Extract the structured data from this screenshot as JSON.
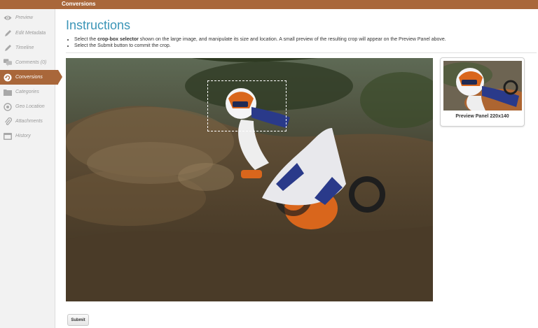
{
  "topbar": {
    "title": "Conversions"
  },
  "sidebar": {
    "items": [
      {
        "label": "Preview",
        "icon": "eye-icon",
        "active": false
      },
      {
        "label": "Edit Metadata",
        "icon": "pencil-icon",
        "active": false
      },
      {
        "label": "Timeline",
        "icon": "pencil-icon",
        "active": false
      },
      {
        "label": "Comments (0)",
        "icon": "comments-icon",
        "active": false
      },
      {
        "label": "Conversions",
        "icon": "refresh-icon",
        "active": true
      },
      {
        "label": "Categories",
        "icon": "folder-icon",
        "active": false
      },
      {
        "label": "Geo Location",
        "icon": "globe-icon",
        "active": false
      },
      {
        "label": "Attachments",
        "icon": "paperclip-icon",
        "active": false
      },
      {
        "label": "History",
        "icon": "calendar-icon",
        "active": false
      }
    ]
  },
  "main": {
    "heading": "Instructions",
    "instructions": {
      "line1_pre": "Select the ",
      "line1_bold": "crop-box selector",
      "line1_post": " shown on the large image, and manipulate its size and location. A small preview of the resulting crop will appear on the Preview Panel above.",
      "line2": "Select the Submit button to commit the crop."
    },
    "preview_label": "Preview Panel 220x140",
    "submit_label": "Submit"
  },
  "colors": {
    "accent": "#a9673a",
    "heading": "#3b95b7",
    "sidebar_bg": "#f2f2f2"
  }
}
